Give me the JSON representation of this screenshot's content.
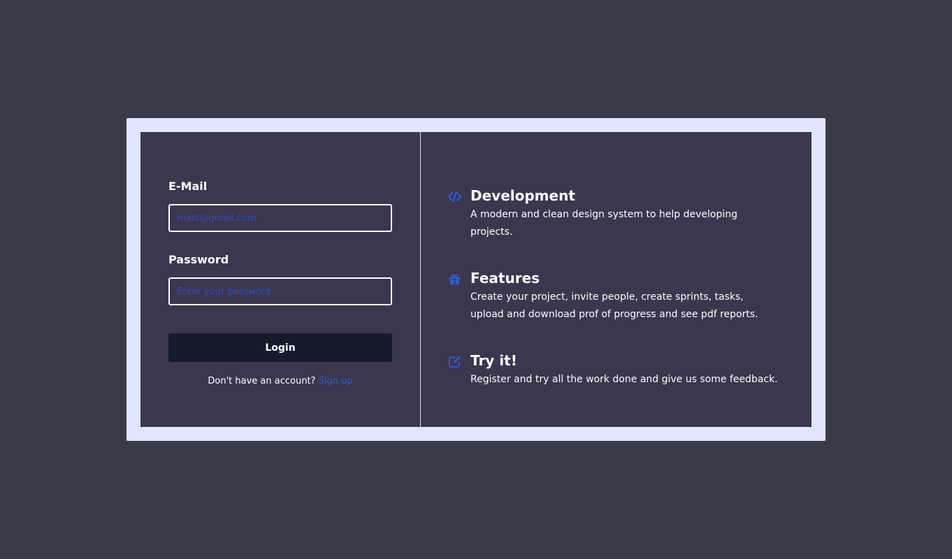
{
  "login": {
    "email_label": "E-Mail",
    "email_placeholder": "mast@gmail.com",
    "password_label": "Password",
    "password_placeholder": "Enter your password",
    "login_button": "Login",
    "signup_prompt": "Don't have an account?",
    "signup_link": "Sign up"
  },
  "features": [
    {
      "icon": "code-icon",
      "title": "Development",
      "description": "A modern and clean design system to help developing projects."
    },
    {
      "icon": "gift-icon",
      "title": "Features",
      "description": "Create your project, invite people, create sprints, tasks, upload and download prof of progress and see pdf reports."
    },
    {
      "icon": "edit-icon",
      "title": "Try it!",
      "description": "Register and try all the work done and give us some feedback."
    }
  ],
  "colors": {
    "background": "#393c48",
    "frame": "#dfe6fd",
    "card": "#3c364e",
    "accent": "#2f5bd8",
    "button": "#141b2d"
  }
}
